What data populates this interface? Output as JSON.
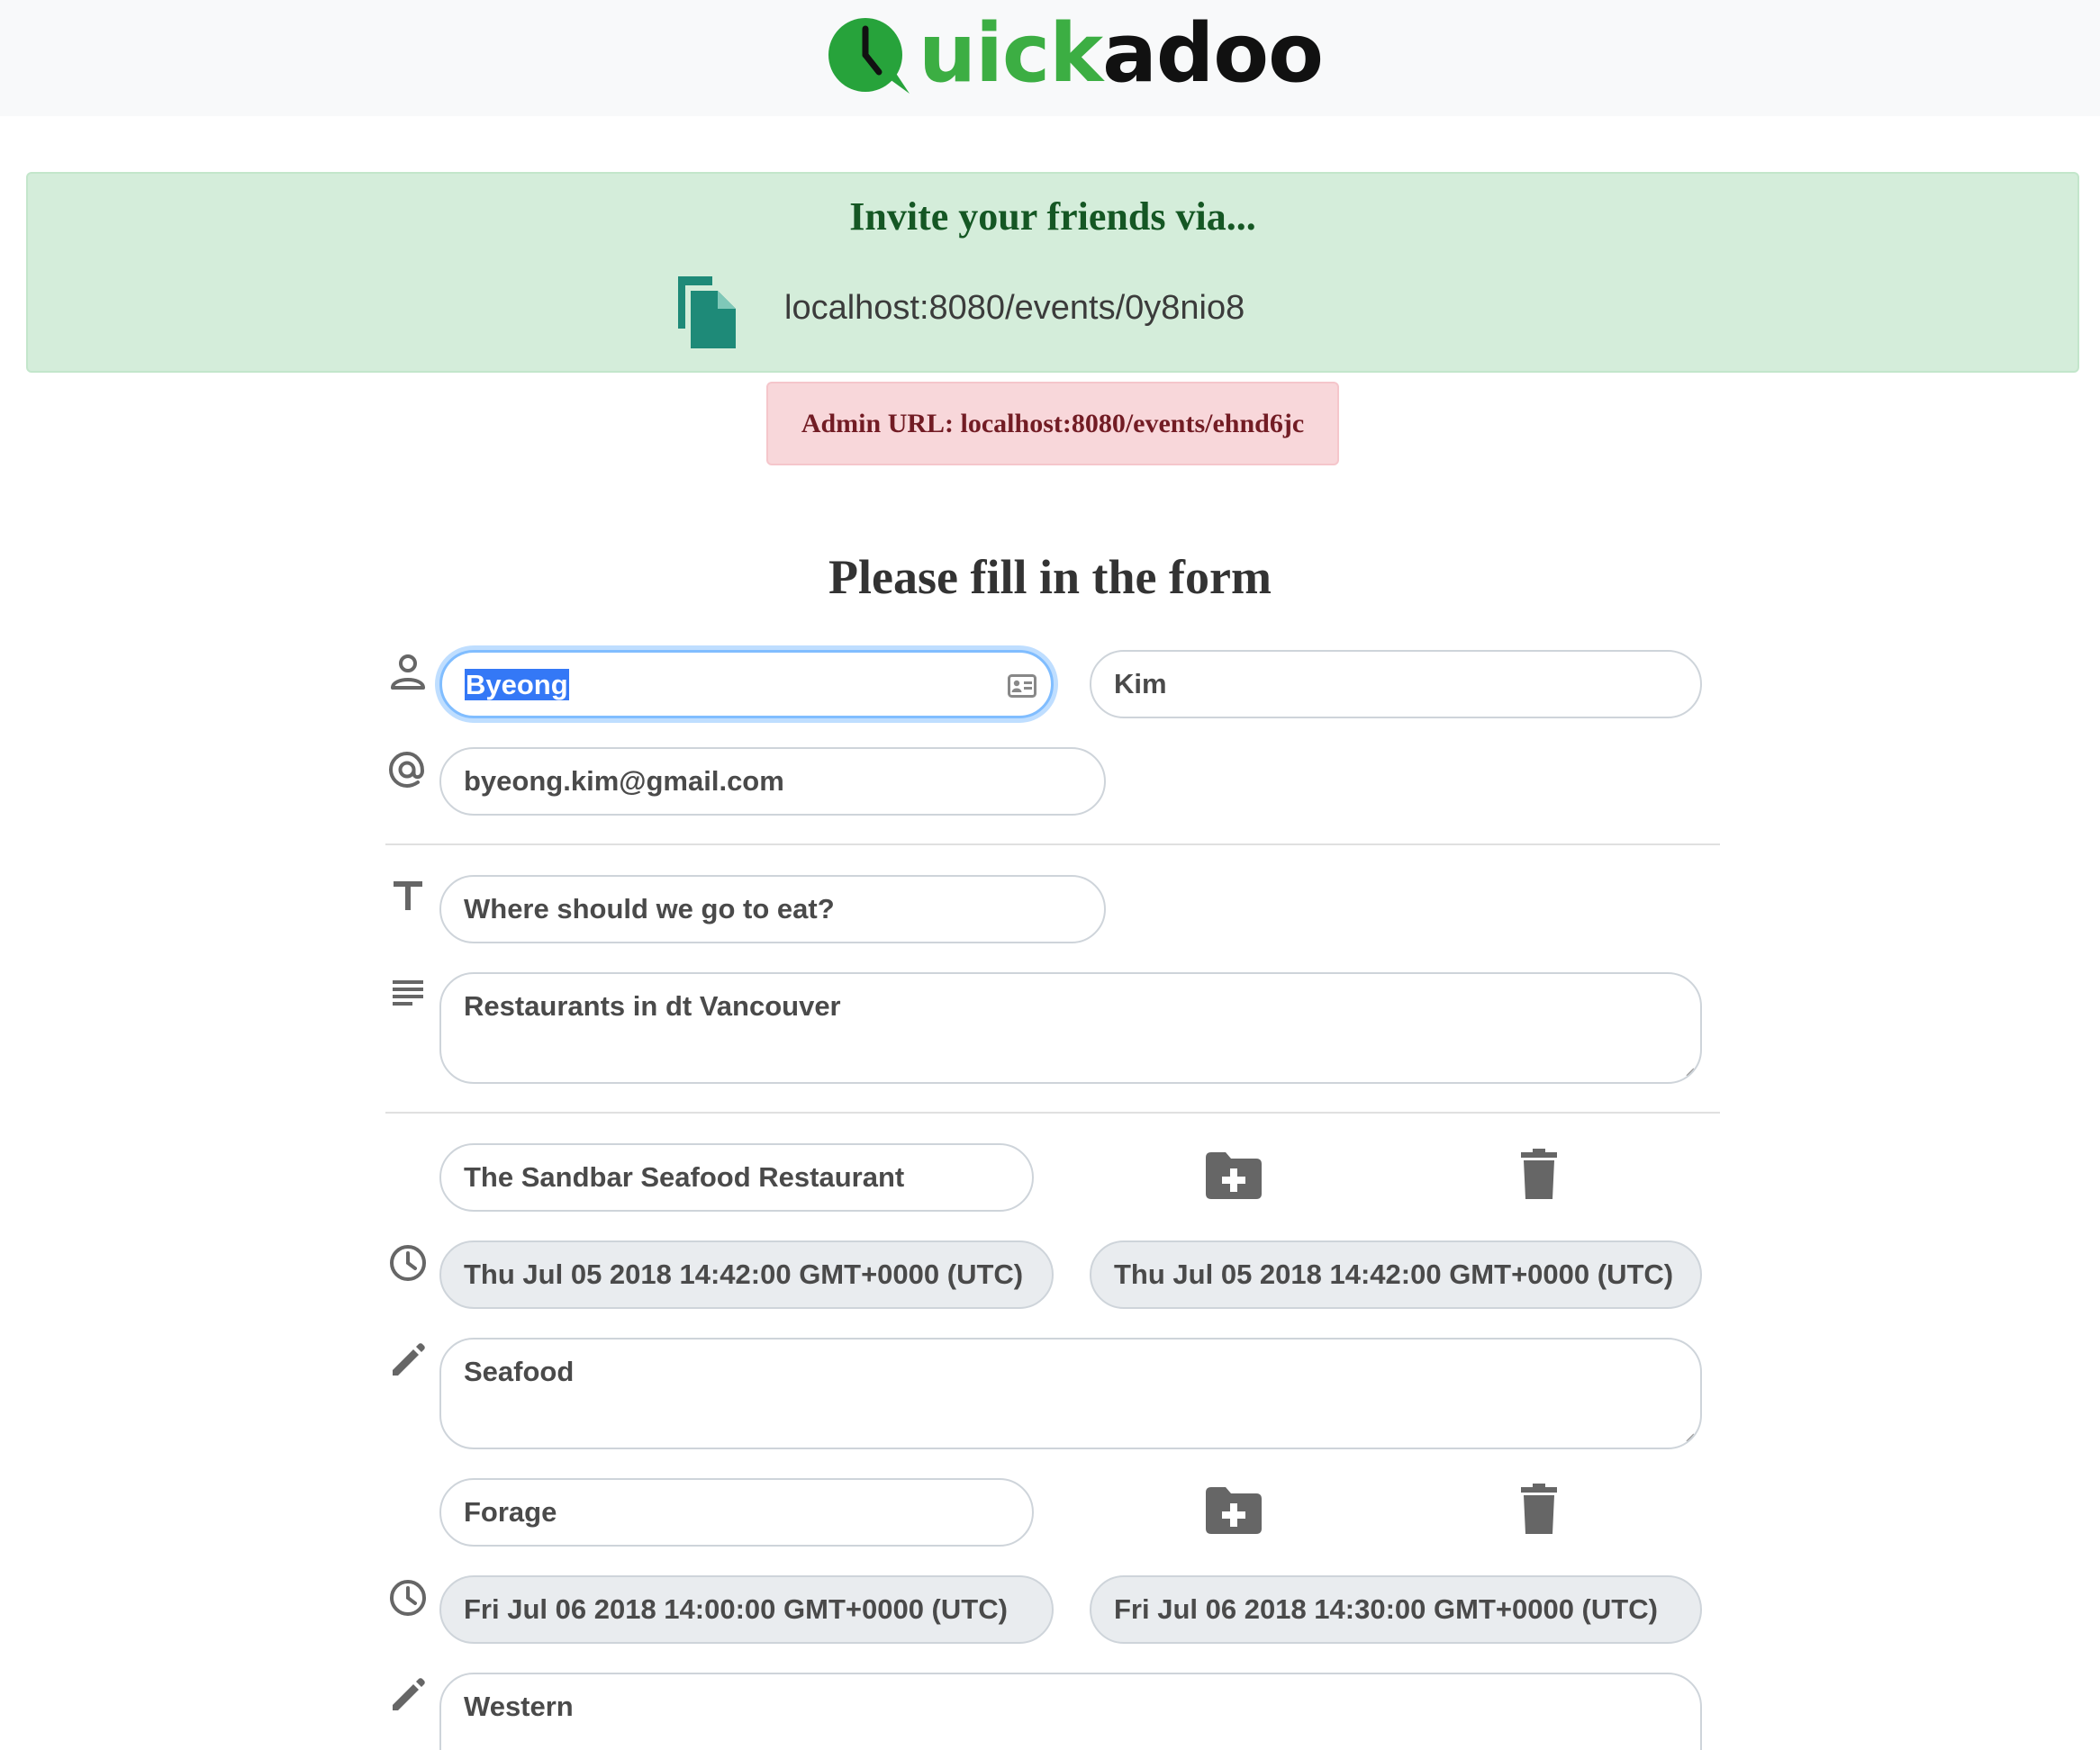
{
  "header": {
    "logo_green": "uick",
    "logo_dark": "adoo"
  },
  "invite": {
    "title": "Invite your friends via...",
    "url": "localhost:8080/events/0y8nio8",
    "icon": "copy-icon"
  },
  "admin": {
    "text": "Admin URL: localhost:8080/events/ehnd6jc"
  },
  "form": {
    "title": "Please fill in the form",
    "first_name": "Byeong",
    "last_name": "Kim",
    "email": "byeong.kim@gmail.com",
    "event_title": "Where should we go to eat?",
    "event_description": "Restaurants in dt Vancouver",
    "options": [
      {
        "name": "The Sandbar Seafood Restaurant",
        "start": "Thu Jul 05 2018 14:42:00 GMT+0000 (UTC)",
        "end": "Thu Jul 05 2018 14:42:00 GMT+0000 (UTC)",
        "notes": "Seafood"
      },
      {
        "name": "Forage",
        "start": "Fri Jul 06 2018 14:00:00 GMT+0000 (UTC)",
        "end": "Fri Jul 06 2018 14:30:00 GMT+0000 (UTC)",
        "notes": "Western"
      }
    ]
  },
  "colors": {
    "brand_green": "#3cae43",
    "success_bg": "#d4edda",
    "danger_bg": "#f8d7da",
    "copy_icon": "#1e8a78",
    "icon_gray": "#666666"
  }
}
